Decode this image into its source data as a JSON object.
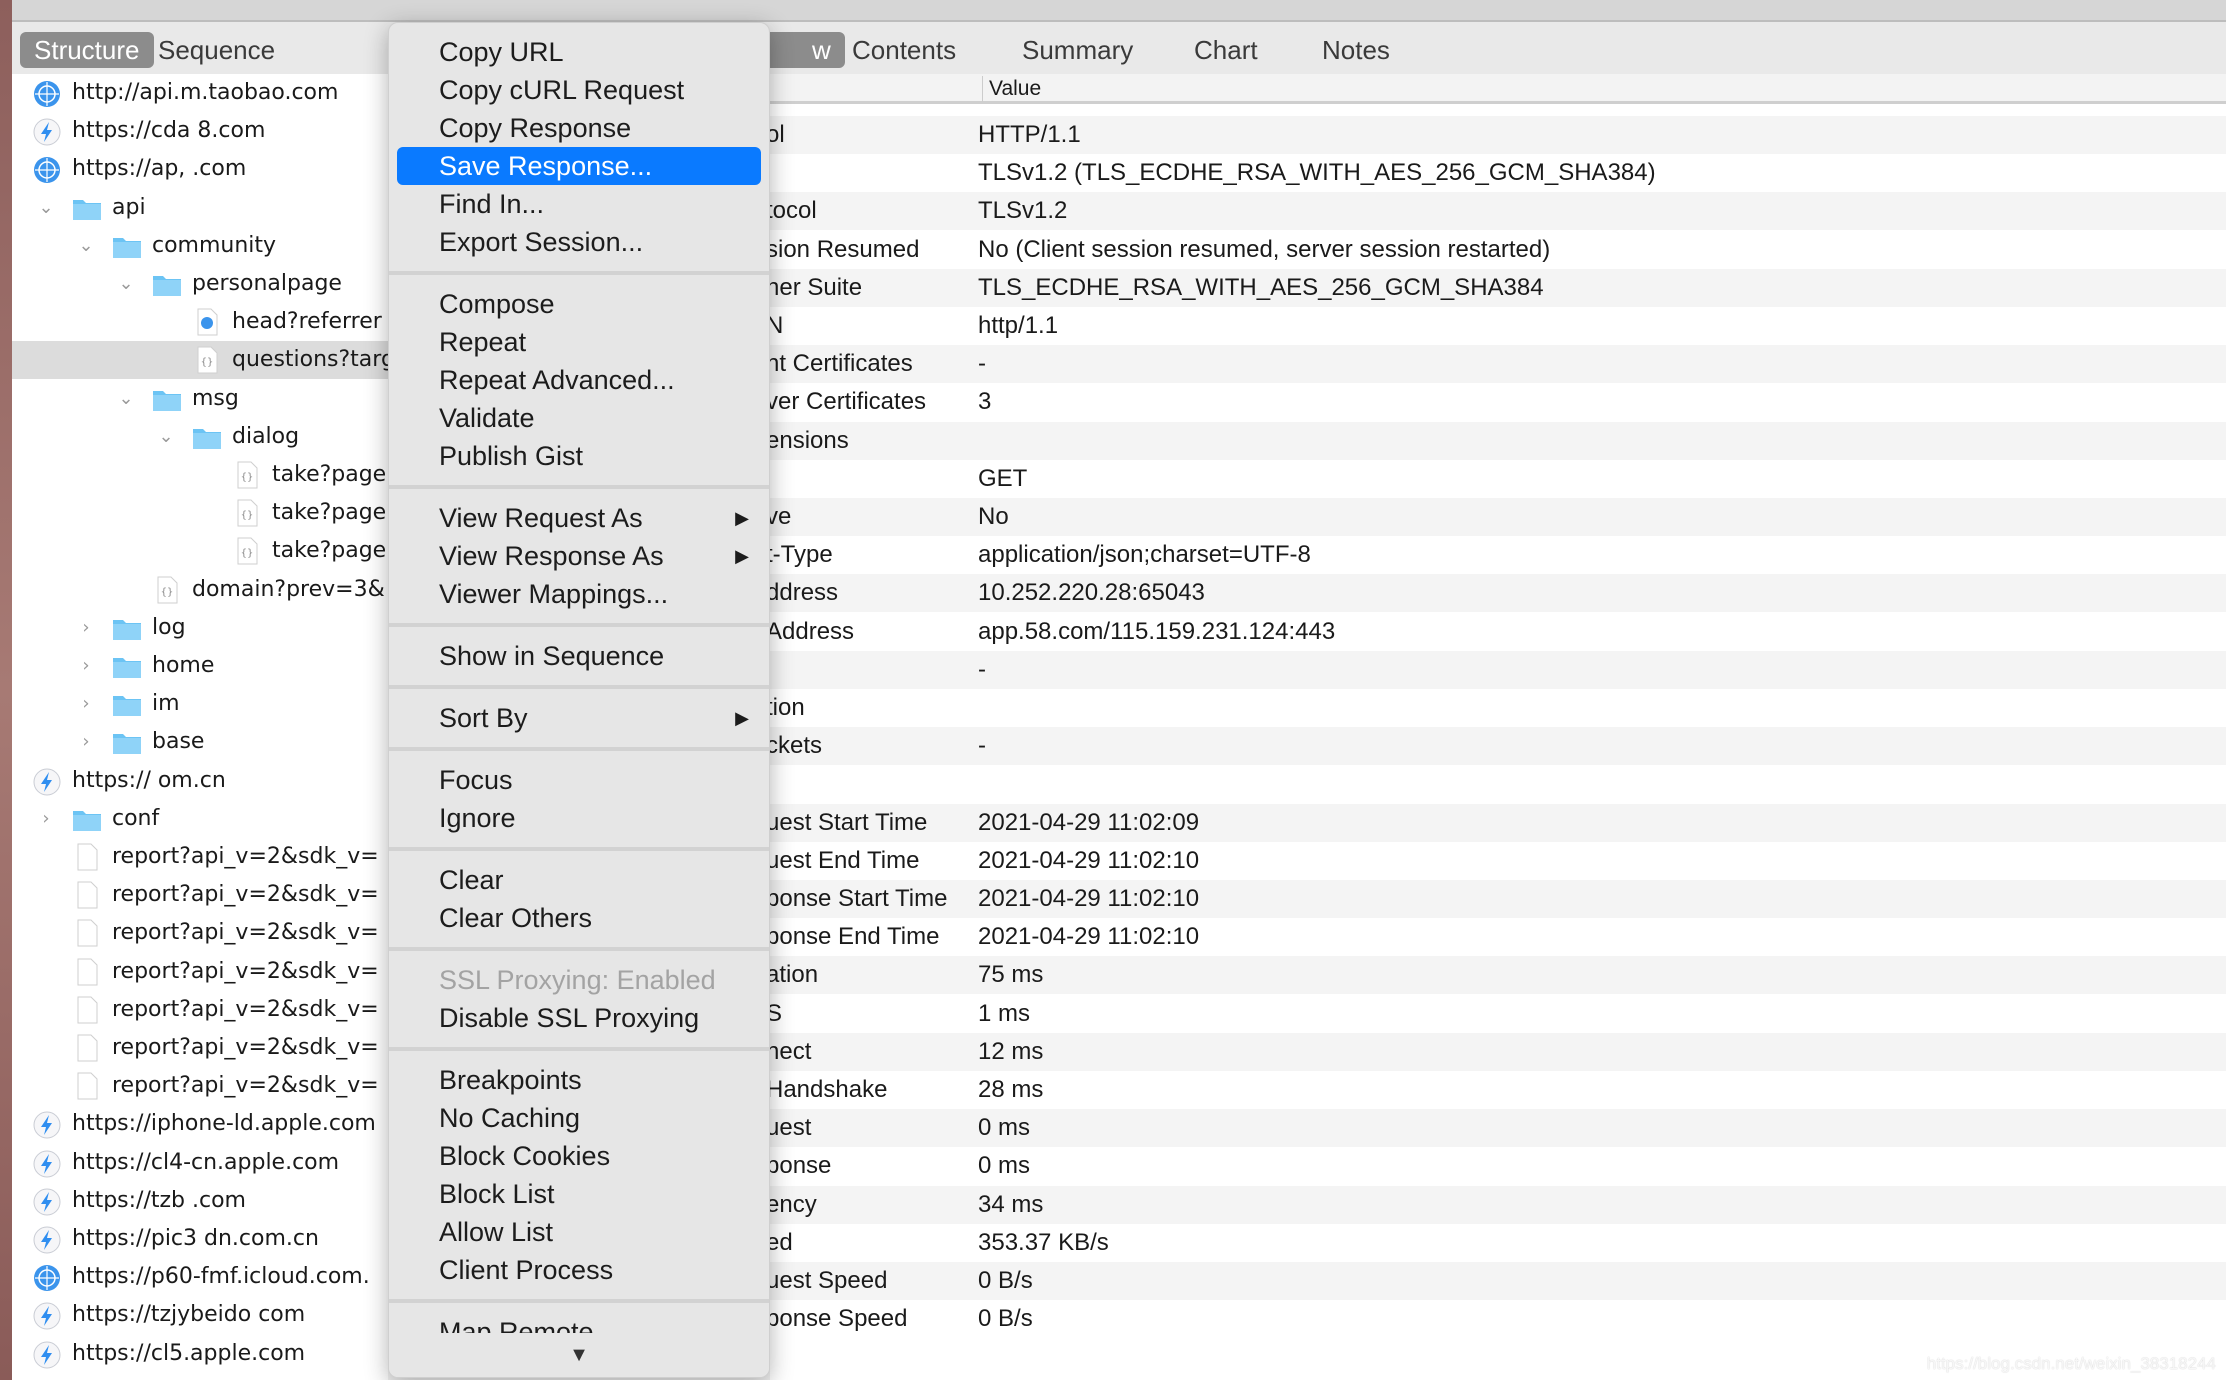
{
  "colors": {
    "accent": "#0a7aff",
    "active_tab": "#8c8c8c"
  },
  "left_tabs": [
    {
      "label": "Structure",
      "active": true
    },
    {
      "label": "Sequence",
      "active": false
    }
  ],
  "right_tabs": [
    {
      "label": "w",
      "active": true
    },
    {
      "label": "Contents"
    },
    {
      "label": "Summary"
    },
    {
      "label": "Chart"
    },
    {
      "label": "Notes"
    }
  ],
  "tree": [
    {
      "label": "http://api.m.taobao.com",
      "icon": "globe-icon",
      "level": 0
    },
    {
      "label": "https://cda   8.com",
      "icon": "bolt-icon",
      "level": 0
    },
    {
      "label": "https://ap,    .com",
      "icon": "globe-icon",
      "level": 0,
      "chevron": "open"
    },
    {
      "label": "api",
      "icon": "folder-icon",
      "level": 1,
      "chevron": "open"
    },
    {
      "label": "community",
      "icon": "folder-icon",
      "level": 2,
      "chevron": "open"
    },
    {
      "label": "personalpage",
      "icon": "folder-icon",
      "level": 3,
      "chevron": "open"
    },
    {
      "label": "head?referrer",
      "icon": "file-globe-icon",
      "level": 4
    },
    {
      "label": "questions?targ",
      "icon": "file-json-icon",
      "level": 4,
      "selected": true
    },
    {
      "label": "msg",
      "icon": "folder-icon",
      "level": 3,
      "chevron": "open"
    },
    {
      "label": "dialog",
      "icon": "folder-icon",
      "level": 4,
      "chevron": "open"
    },
    {
      "label": "take?page",
      "icon": "file-json-icon",
      "level": 5
    },
    {
      "label": "take?page",
      "icon": "file-json-icon",
      "level": 5
    },
    {
      "label": "take?page",
      "icon": "file-json-icon",
      "level": 5
    },
    {
      "label": "domain?prev=3&",
      "icon": "file-json-icon",
      "level": 3
    },
    {
      "label": "log",
      "icon": "folder-icon",
      "level": 2,
      "chevron": "closed"
    },
    {
      "label": "home",
      "icon": "folder-icon",
      "level": 2,
      "chevron": "closed"
    },
    {
      "label": "im",
      "icon": "folder-icon",
      "level": 2,
      "chevron": "closed"
    },
    {
      "label": "base",
      "icon": "folder-icon",
      "level": 2,
      "chevron": "closed"
    },
    {
      "label": "https://          om.cn",
      "icon": "bolt-icon",
      "level": 0
    },
    {
      "label": "conf",
      "icon": "folder-icon",
      "level": 1,
      "chevron": "closed"
    },
    {
      "label": "report?api_v=2&sdk_v=",
      "icon": "file-icon",
      "level": 1
    },
    {
      "label": "report?api_v=2&sdk_v=",
      "icon": "file-icon",
      "level": 1
    },
    {
      "label": "report?api_v=2&sdk_v=",
      "icon": "file-icon",
      "level": 1
    },
    {
      "label": "report?api_v=2&sdk_v=",
      "icon": "file-icon",
      "level": 1
    },
    {
      "label": "report?api_v=2&sdk_v=",
      "icon": "file-icon",
      "level": 1
    },
    {
      "label": "report?api_v=2&sdk_v=",
      "icon": "file-icon",
      "level": 1
    },
    {
      "label": "report?api_v=2&sdk_v=",
      "icon": "file-icon",
      "level": 1
    },
    {
      "label": "https://iphone-ld.apple.com",
      "icon": "bolt-icon",
      "level": 0
    },
    {
      "label": "https://cl4-cn.apple.com",
      "icon": "bolt-icon",
      "level": 0
    },
    {
      "label": "https://tzb    .com",
      "icon": "bolt-icon",
      "level": 0
    },
    {
      "label": "https://pic3       dn.com.cn",
      "icon": "bolt-icon",
      "level": 0
    },
    {
      "label": "https://p60-fmf.icloud.com.",
      "icon": "globe-icon",
      "level": 0
    },
    {
      "label": "https://tzjybeido      com",
      "icon": "bolt-icon",
      "level": 0
    },
    {
      "label": "https://cl5.apple.com",
      "icon": "bolt-icon",
      "level": 0
    }
  ],
  "detail_header": {
    "value": "Value"
  },
  "details": [
    {
      "label": "ol",
      "value": "HTTP/1.1"
    },
    {
      "label": "",
      "value": "TLSv1.2 (TLS_ECDHE_RSA_WITH_AES_256_GCM_SHA384)"
    },
    {
      "label": "tocol",
      "value": "TLSv1.2"
    },
    {
      "label": "sion Resumed",
      "value": "No (Client session resumed, server session restarted)"
    },
    {
      "label": "her Suite",
      "value": "TLS_ECDHE_RSA_WITH_AES_256_GCM_SHA384"
    },
    {
      "label": "N",
      "value": "http/1.1"
    },
    {
      "label": "nt Certificates",
      "value": "-"
    },
    {
      "label": "ver Certificates",
      "value": "3"
    },
    {
      "label": "ensions",
      "value": ""
    },
    {
      "label": "",
      "value": "GET"
    },
    {
      "label": "ve",
      "value": "No"
    },
    {
      "label": "t-Type",
      "value": "application/json;charset=UTF-8"
    },
    {
      "label": "ddress",
      "value": "10.252.220.28:65043"
    },
    {
      "label": " Address",
      "value": "app.58.com/115.159.231.124:443"
    },
    {
      "label": "",
      "value": "-"
    },
    {
      "label": "tion",
      "value": ""
    },
    {
      "label": "ckets",
      "value": "-"
    },
    {
      "label": "",
      "value": ""
    },
    {
      "label": "uest Start Time",
      "value": "2021-04-29 11:02:09"
    },
    {
      "label": "uest End Time",
      "value": "2021-04-29 11:02:10"
    },
    {
      "label": "ponse Start Time",
      "value": "2021-04-29 11:02:10"
    },
    {
      "label": "ponse End Time",
      "value": "2021-04-29 11:02:10"
    },
    {
      "label": "ation",
      "value": "75 ms"
    },
    {
      "label": "S",
      "value": "1 ms"
    },
    {
      "label": "nect",
      "value": "12 ms"
    },
    {
      "label": " Handshake",
      "value": "28 ms"
    },
    {
      "label": "uest",
      "value": "0 ms"
    },
    {
      "label": "ponse",
      "value": "0 ms"
    },
    {
      "label": "ency",
      "value": "34 ms"
    },
    {
      "label": "ed",
      "value": "353.37 KB/s"
    },
    {
      "label": "uest Speed",
      "value": "0 B/s"
    },
    {
      "label": "ponse Speed",
      "value": "0 B/s"
    }
  ],
  "menu": [
    [
      {
        "label": "Copy URL"
      },
      {
        "label": "Copy cURL Request"
      },
      {
        "label": "Copy Response"
      },
      {
        "label": "Save Response...",
        "highlighted": true
      },
      {
        "label": "Find In..."
      },
      {
        "label": "Export Session..."
      }
    ],
    [
      {
        "label": "Compose"
      },
      {
        "label": "Repeat"
      },
      {
        "label": "Repeat Advanced..."
      },
      {
        "label": "Validate"
      },
      {
        "label": "Publish Gist"
      }
    ],
    [
      {
        "label": "View Request As",
        "submenu": true
      },
      {
        "label": "View Response As",
        "submenu": true
      },
      {
        "label": "Viewer Mappings..."
      }
    ],
    [
      {
        "label": "Show in Sequence"
      }
    ],
    [
      {
        "label": "Sort By",
        "submenu": true
      }
    ],
    [
      {
        "label": "Focus"
      },
      {
        "label": "Ignore"
      }
    ],
    [
      {
        "label": "Clear"
      },
      {
        "label": "Clear Others"
      }
    ],
    [
      {
        "label": "SSL Proxying: Enabled",
        "disabled": true
      },
      {
        "label": "Disable SSL Proxying"
      }
    ],
    [
      {
        "label": "Breakpoints"
      },
      {
        "label": "No Caching"
      },
      {
        "label": "Block Cookies"
      },
      {
        "label": "Block List"
      },
      {
        "label": "Allow List"
      },
      {
        "label": "Client Process"
      }
    ],
    [
      {
        "label": "Map Remote"
      }
    ]
  ],
  "menu_scroll_arrow": "▼",
  "watermark": "https://blog.csdn.net/weixin_38318244"
}
